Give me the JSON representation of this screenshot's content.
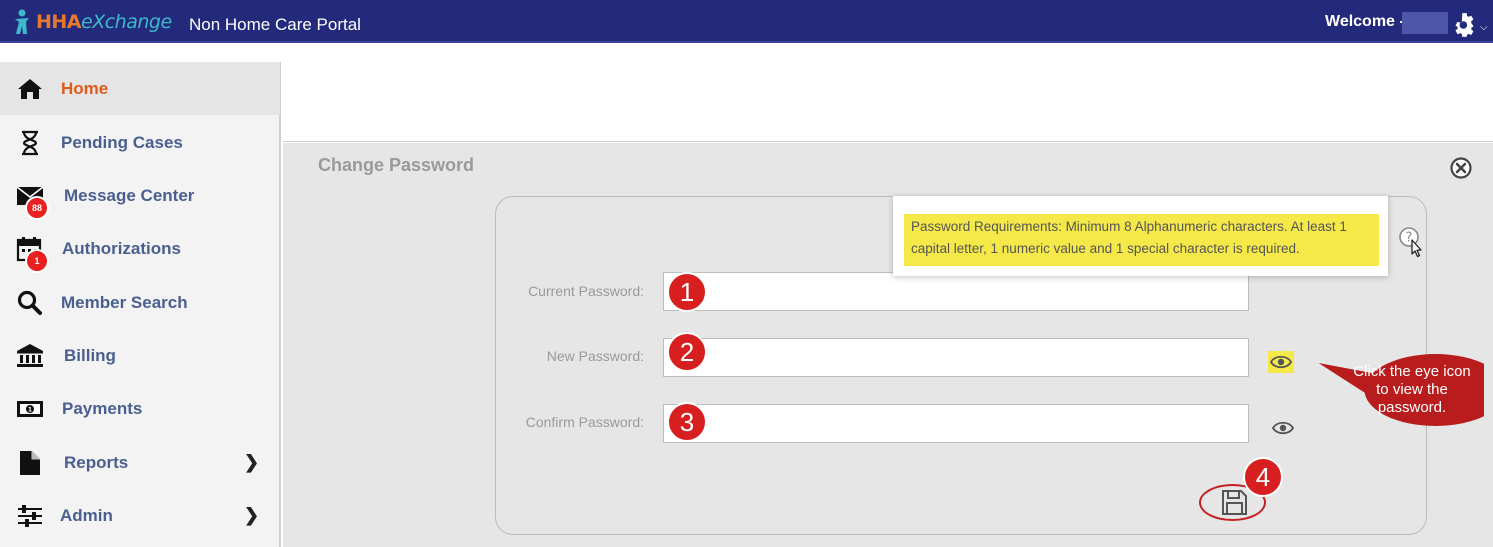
{
  "header": {
    "logo_hha": "HHA",
    "logo_exchange": "eXchange",
    "portal_title": "Non Home Care Portal",
    "welcome": "Welcome -",
    "gear_icon": "gear-icon",
    "colors": {
      "bar": "#232a7c",
      "logo_orange": "#e8782a",
      "logo_teal": "#3fb8c9"
    }
  },
  "sidebar": {
    "items": [
      {
        "label": "Home",
        "icon": "home-icon",
        "active": true
      },
      {
        "label": "Pending Cases",
        "icon": "hourglass-icon"
      },
      {
        "label": "Message Center",
        "icon": "envelope-icon",
        "badge": "88"
      },
      {
        "label": "Authorizations",
        "icon": "calendar-icon",
        "badge": "1"
      },
      {
        "label": "Member Search",
        "icon": "search-icon"
      },
      {
        "label": "Billing",
        "icon": "bank-icon"
      },
      {
        "label": "Payments",
        "icon": "money-icon"
      },
      {
        "label": "Reports",
        "icon": "document-icon",
        "has_submenu": true
      },
      {
        "label": "Admin",
        "icon": "sliders-icon",
        "has_submenu": true
      }
    ],
    "colors": {
      "label": "#4a5f8f",
      "active_label": "#e05a18"
    }
  },
  "panel": {
    "title": "Change Password",
    "close_icon": "close-circle-icon",
    "tooltip": "Password Requirements: Minimum 8 Alphanumeric characters. At least 1 capital letter, 1 numeric value and 1 special character is required.",
    "fields": [
      {
        "label": "Current Password:",
        "value": "",
        "step": "1"
      },
      {
        "label": "New Password:",
        "value": "",
        "step": "2"
      },
      {
        "label": "Confirm Password:",
        "value": "",
        "step": "3"
      }
    ],
    "save_step": "4",
    "callout": "Click the eye icon to view the password.",
    "colors": {
      "highlight": "#f5e94a",
      "annotation_red": "#d81f1f",
      "callout_red": "#b81c1c"
    }
  }
}
